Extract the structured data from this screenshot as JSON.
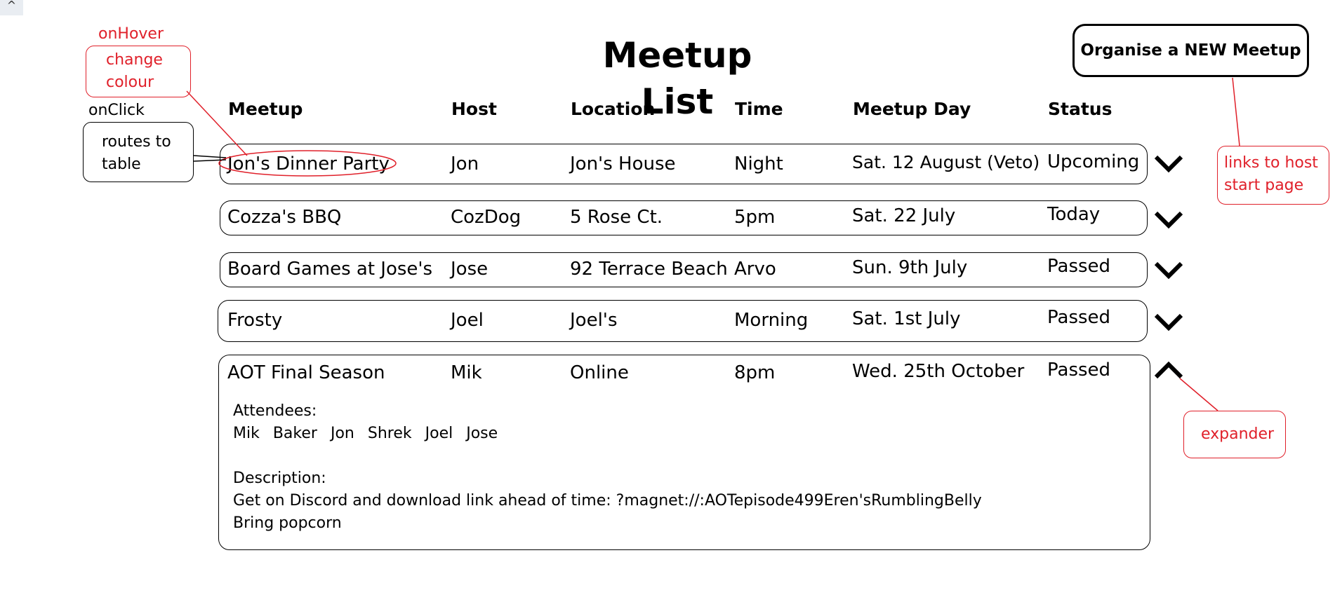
{
  "corner_caret": "^",
  "page_title": "Meetup List",
  "new_meetup_button": "Organise a NEW Meetup",
  "columns": [
    "Meetup",
    "Host",
    "Location",
    "Time",
    "Meetup Day",
    "Status"
  ],
  "meetups": [
    {
      "name": "Jon's Dinner Party",
      "host": "Jon",
      "location": "Jon's House",
      "time": "Night",
      "day": "Sat. 12 August",
      "veto": "(Veto)",
      "status": "Upcoming",
      "expanded": false
    },
    {
      "name": "Cozza's BBQ",
      "host": "CozDog",
      "location": "5 Rose Ct.",
      "time": "5pm",
      "day": "Sat. 22 July",
      "status": "Today",
      "expanded": false
    },
    {
      "name": "Board Games at Jose's",
      "host": "Jose",
      "location": "92 Terrace Beach",
      "time": "Arvo",
      "day": "Sun. 9th July",
      "status": "Passed",
      "expanded": false
    },
    {
      "name": "Frosty",
      "host": "Joel",
      "location": "Joel's",
      "time": "Morning",
      "day": "Sat. 1st July",
      "status": "Passed",
      "expanded": false
    },
    {
      "name": "AOT Final Season",
      "host": "Mik",
      "location": "Online",
      "time": "8pm",
      "day": "Wed. 25th October",
      "status": "Passed",
      "expanded": true
    }
  ],
  "details": {
    "attendees_label": "Attendees:",
    "attendees": [
      "Mik",
      "Baker",
      "Jon",
      "Shrek",
      "Joel",
      "Jose"
    ],
    "description_label": "Description:",
    "description_lines": [
      "Get on Discord and download link ahead of time: ?magnet://:AOTepisode499Eren'sRumblingBelly",
      "Bring popcorn"
    ]
  },
  "annotations": {
    "on_hover_title": "onHover",
    "on_hover_lines": [
      "change",
      "colour"
    ],
    "on_click_title": "onClick",
    "on_click_lines": [
      "routes to",
      "table"
    ],
    "host_link_lines": [
      "links to host",
      "start page"
    ],
    "expander_label": "expander"
  },
  "colors": {
    "annotation_red": "#e0202a",
    "border": "#000000"
  }
}
